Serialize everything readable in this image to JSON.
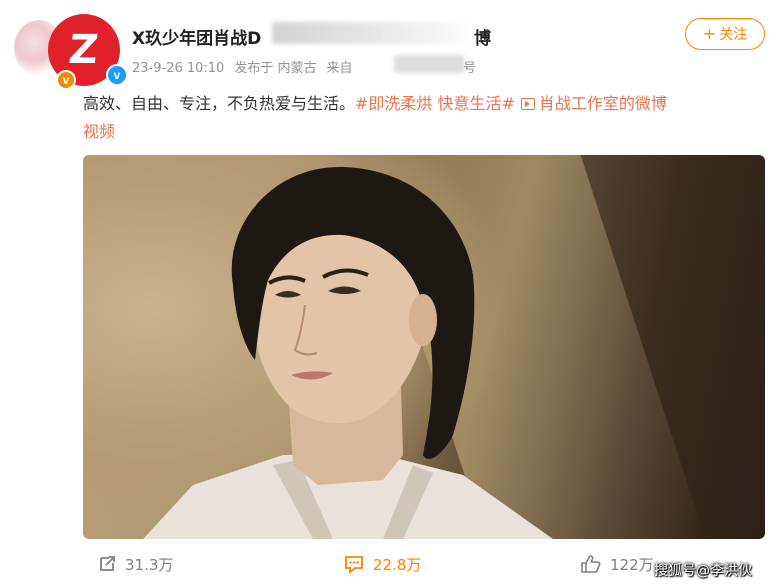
{
  "post": {
    "author": {
      "name_visible": "X玖少年团肖战D",
      "name_tail": "博",
      "avatar_letter": "Z",
      "badge_orange": "v",
      "badge_blue": "v"
    },
    "meta": {
      "time": "23-9-26 10:10",
      "location": "发布于 内蒙古",
      "source_prefix": "来自 ",
      "source_tail": "号"
    },
    "follow_label": "关注",
    "follow_plus": "+",
    "text": {
      "body": "高效、自由、专注，不负热爱与生活。",
      "topic": "#即洗柔烘 快意生活#",
      "video_link_line1": "肖战工作室的微博",
      "video_link_line2": "视频"
    },
    "actions": {
      "repost_count": "31.3万",
      "comment_count": "22.8万",
      "like_count": "122万"
    },
    "watermark": "搜狐号@李洪伙"
  },
  "colors": {
    "accent": "#ff8200",
    "topic": "#eb7350",
    "meta": "#939393",
    "avatar_red": "#e0202a",
    "verified_blue": "#1a9dff"
  }
}
